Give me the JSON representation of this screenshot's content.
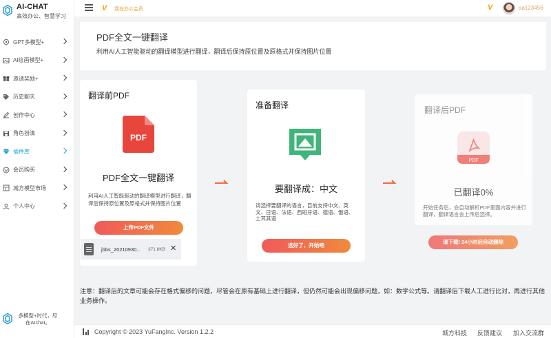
{
  "brand": {
    "name": "AI-CHAT",
    "slogan": "高效办公、智慧学习"
  },
  "header": {
    "vip_text": "我在办公会员",
    "username": "aa123456"
  },
  "sidebar": {
    "items": [
      {
        "label": "GPT多模型+",
        "icon": "gpt-icon"
      },
      {
        "label": "AI绘画模型+",
        "icon": "image-icon"
      },
      {
        "label": "邀请奖励+",
        "icon": "gift-icon"
      },
      {
        "label": "历史聊天",
        "icon": "tag-icon"
      },
      {
        "label": "创作中心",
        "icon": "edit-icon"
      },
      {
        "label": "角色扮演",
        "icon": "save-icon"
      },
      {
        "label": "插件库",
        "icon": "diamond-icon",
        "active": true
      },
      {
        "label": "会员购买",
        "icon": "vip-icon"
      },
      {
        "label": "城方模型市场",
        "icon": "grid-icon"
      },
      {
        "label": "个人中心",
        "icon": "user-icon"
      }
    ],
    "footer_text": "多模型+时代，尽在AIchat。"
  },
  "intro": {
    "title": "PDF全文一键翻译",
    "desc": "利用AI人工智能驱动的翻译模型进行翻译，翻译后保持原位置及原格式并保持图片位置"
  },
  "card_before": {
    "title": "翻译前PDF",
    "big": "PDF全文一键翻译",
    "desc": "利用AI人工智能驱动的翻译模型进行翻译，翻译后保持原位置及原格式并保持图片位置",
    "upload_label": "上传PDF文件",
    "pdf_label": "PDF",
    "file": {
      "name": "jbbs_20210930...",
      "size": "371.8KB",
      "close": "✕"
    }
  },
  "card_prepare": {
    "title": "准备翻译",
    "big": "要翻译成：中文",
    "desc": "请选择要翻译的语言，目前支持中文、英文、日语、法语、西班牙语、德语、俄语、土耳其语",
    "start_label": "选好了，开始吧"
  },
  "card_after": {
    "title": "翻译后PDF",
    "big": "已翻译0%",
    "desc": "开始任务后，会自动解析PDF里面内容并进行翻译，翻译语言会上传后选择。",
    "download_label": "请下载! 24小时后自动删除",
    "pdf_label": "PDF"
  },
  "note": "注意：翻译后的文章可能会存在格式偏移的问题，尽管会在原有基础上进行翻译，但仍然可能会出现偏移问题，如：数学公式等。请翻译后下载人工进行比对，再进行其他业务操作。",
  "footer": {
    "copyright": "Copyright © 2023 YuFangInc. Version 1.2.2",
    "links": [
      "城方科技",
      "反馈建议",
      "加入交流群"
    ]
  },
  "colors": {
    "accent": "#1aa3d1",
    "button_from": "#f05a5a",
    "button_to": "#f08a3c",
    "pdf_red": "#e8453c",
    "msg_green": "#3fb57a"
  }
}
